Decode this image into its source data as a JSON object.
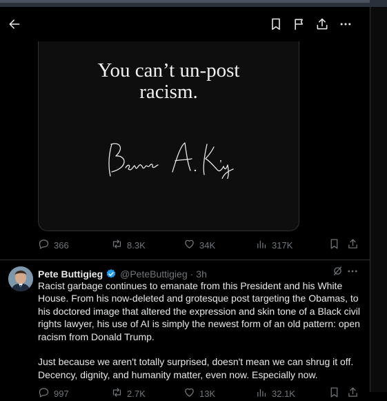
{
  "quote_card": {
    "line1": "You can’t un-post",
    "line2": "racism.",
    "signature": "Bernice A. King"
  },
  "tweet1_actions": {
    "replies": "366",
    "reposts": "8.3K",
    "likes": "34K",
    "views": "317K"
  },
  "tweet2": {
    "author_name": "Pete Buttigieg",
    "handle": "@PeteButtigieg",
    "separator": "·",
    "time": "3h",
    "paragraph1": "Racist garbage continues to emanate from this President and his White House. From his now-deleted and grotesque post targeting the Obamas, to his doctored image that altered the expression and skin tone of a Black civil rights lawyer, his use of AI is simply the newest form of an old pattern: open racism from Donald Trump.",
    "paragraph2": "Just because we aren't totally surprised, doesn't mean we can shrug it off. Decency, dignity, and humanity matter, even now. Especially now."
  },
  "tweet2_actions": {
    "replies": "997",
    "reposts": "2.7K",
    "likes": "13K",
    "views": "32.1K"
  },
  "colors": {
    "background": "#000000",
    "text": "#e7e9ea",
    "muted": "#71767b",
    "verified": "#1d9bf0",
    "border": "#2f3336"
  },
  "icons": [
    "back-arrow-icon",
    "bookmark-icon",
    "flag-icon",
    "share-icon",
    "more-icon",
    "reply-icon",
    "repost-icon",
    "like-icon",
    "views-icon",
    "verified-badge-icon",
    "grok-icon"
  ]
}
